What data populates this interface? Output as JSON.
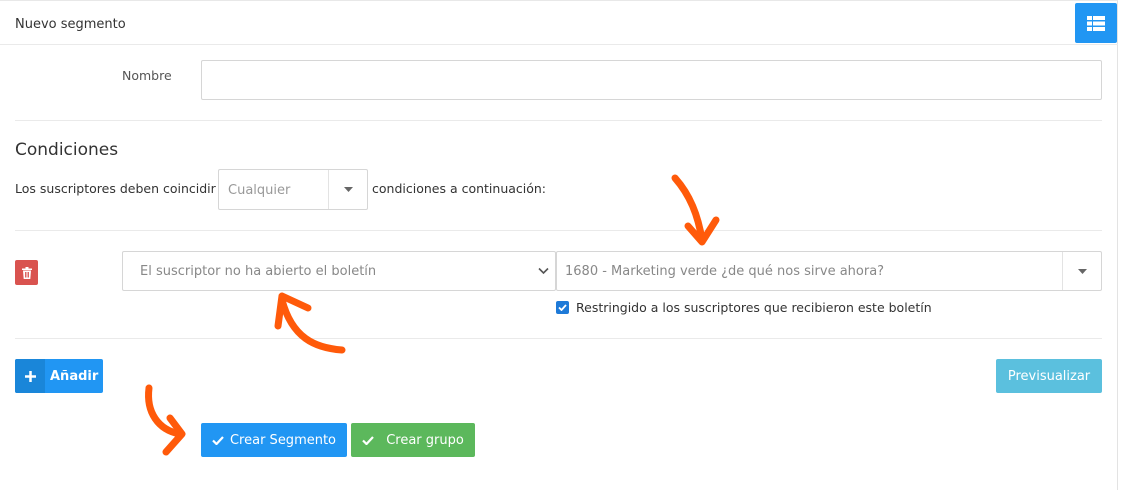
{
  "header": {
    "title": "Nuevo segmento"
  },
  "form": {
    "name_label": "Nombre",
    "name_value": "",
    "conditions_title": "Condiciones",
    "must_match_text": "Los suscriptores deben coincidir",
    "match_select_value": "Cualquier",
    "after_text": "condiciones a continuación:"
  },
  "condition": {
    "type_value": "El suscriptor no ha abierto el boletín",
    "newsletter_value": "1680 - Marketing verde ¿de qué nos sirve ahora?",
    "restrict_label": "Restringido a los suscriptores que recibieron este boletín",
    "restrict_checked": true
  },
  "actions": {
    "add_label": "Añadir",
    "preview_label": "Previsualizar",
    "create_segment_label": "Crear Segmento",
    "create_group_label": "Crear grupo"
  },
  "colors": {
    "primary": "#2196f3",
    "info": "#5bc0de",
    "success": "#5cb85c",
    "danger": "#d9534f",
    "annotation": "#ff5a0a"
  }
}
